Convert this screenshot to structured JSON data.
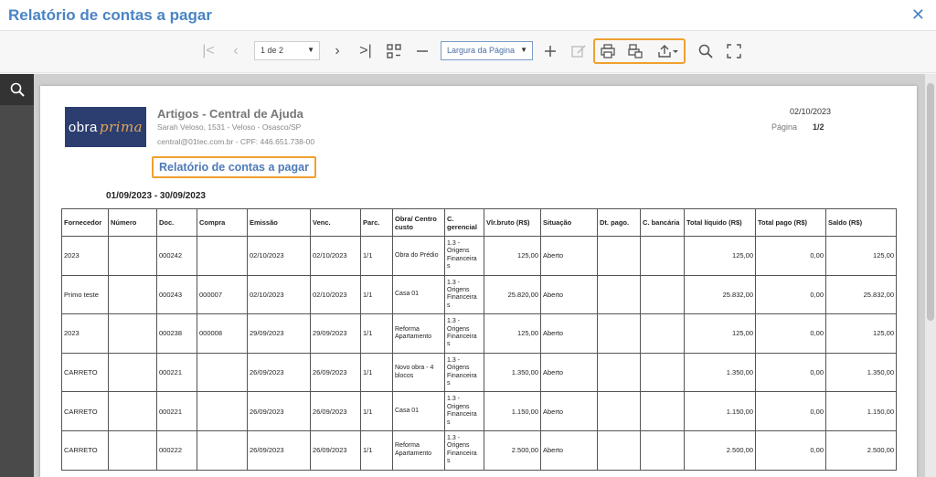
{
  "window": {
    "title": "Relatório de contas a pagar",
    "close_icon": "close-icon"
  },
  "toolbar": {
    "page_select": "1 de 2",
    "zoom_select": "Largura da Página",
    "icons": [
      "first-page-icon",
      "prev-page-icon",
      "next-page-icon",
      "last-page-icon",
      "multipage-icon",
      "zoom-out-icon",
      "zoom-in-icon",
      "edit-icon",
      "print-icon",
      "print-page-icon",
      "export-icon",
      "search-icon",
      "fullscreen-icon"
    ]
  },
  "report": {
    "logo_text_1": "obra",
    "logo_text_2": "prima",
    "company": "Artigos - Central de Ajuda",
    "address": "Sarah Veloso, 1531 - Veloso - Osasco/SP",
    "contact": "central@01tec.com.br  - CPF: 446.651.738-00",
    "title": "Relatório de contas a pagar",
    "date": "02/10/2023",
    "page_label": "Página",
    "page_value": "1/2",
    "period": "01/09/2023 - 30/09/2023",
    "headers": [
      "Fornecedor",
      "Número",
      "Doc.",
      "Compra",
      "Emissão",
      "Venc.",
      "Parc.",
      "Obra/ Centro custo",
      "C. gerencial",
      "Vlr.bruto (R$)",
      "Situação",
      "Dt. pago.",
      "C. bancária",
      "Total líquido (R$)",
      "Total pago (R$)",
      "Saldo (R$)"
    ],
    "rows": [
      [
        "2023",
        "",
        "000242",
        "",
        "02/10/2023",
        "02/10/2023",
        "1/1",
        "Obra do Prédio",
        "1.3 - Origens Financeira s",
        "125,00",
        "Aberto",
        "",
        "",
        "125,00",
        "0,00",
        "125,00"
      ],
      [
        "Primo teste",
        "",
        "000243",
        "000007",
        "02/10/2023",
        "02/10/2023",
        "1/1",
        "Casa 01",
        "1.3 - Origens Financeira s",
        "25.820,00",
        "Aberto",
        "",
        "",
        "25.832,00",
        "0,00",
        "25.832,00"
      ],
      [
        "2023",
        "",
        "000238",
        "000008",
        "29/09/2023",
        "29/09/2023",
        "1/1",
        "Reforma Apartamento",
        "1.3 - Origens Financeira s",
        "125,00",
        "Aberto",
        "",
        "",
        "125,00",
        "0,00",
        "125,00"
      ],
      [
        "CARRETO",
        "",
        "000221",
        "",
        "26/09/2023",
        "26/09/2023",
        "1/1",
        "Novo obra - 4 blocos",
        "1.3 - Origens Financeira s",
        "1.350,00",
        "Aberto",
        "",
        "",
        "1.350,00",
        "0,00",
        "1.350,00"
      ],
      [
        "CARRETO",
        "",
        "000221",
        "",
        "26/09/2023",
        "26/09/2023",
        "1/1",
        "Casa 01",
        "1.3 - Origens Financeira s",
        "1.150,00",
        "Aberto",
        "",
        "",
        "1.150,00",
        "0,00",
        "1.150,00"
      ],
      [
        "CARRETO",
        "",
        "000222",
        "",
        "26/09/2023",
        "26/09/2023",
        "1/1",
        "Reforma Apartamento",
        "1.3 - Origens Financeira s",
        "2.500,00",
        "Aberto",
        "",
        "",
        "2.500,00",
        "0,00",
        "2.500,00"
      ]
    ]
  }
}
